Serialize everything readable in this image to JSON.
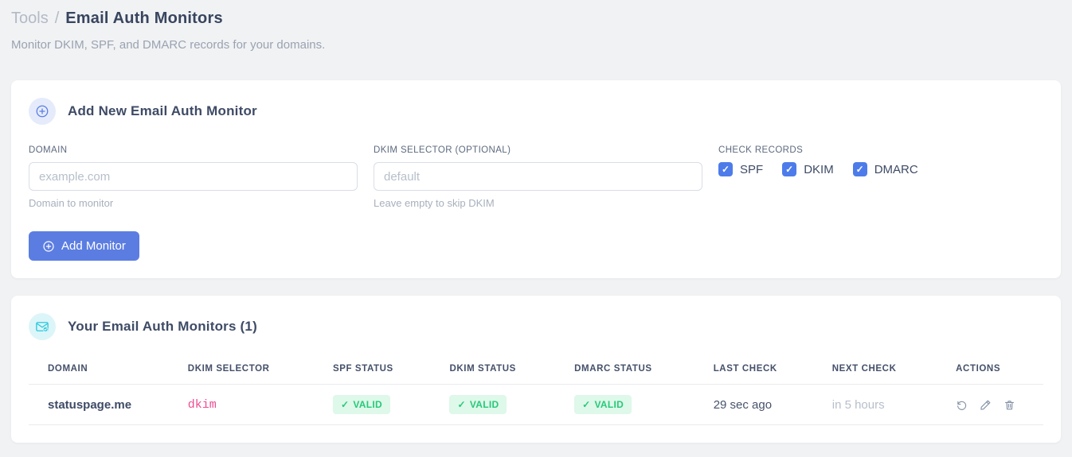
{
  "page": {
    "breadcrumb_root": "Tools",
    "breadcrumb_separator": "/",
    "title": "Email Auth Monitors",
    "subtitle": "Monitor DKIM, SPF, and DMARC records for your domains."
  },
  "glyphs": {
    "check": "✓"
  },
  "add_card": {
    "icon": "plus-circle-icon",
    "title": "Add New Email Auth Monitor",
    "domain_field": {
      "label": "DOMAIN",
      "placeholder": "example.com",
      "value": "",
      "hint": "Domain to monitor"
    },
    "dkim_field": {
      "label": "DKIM SELECTOR (OPTIONAL)",
      "placeholder": "default",
      "value": "",
      "hint": "Leave empty to skip DKIM"
    },
    "check_records": {
      "label": "CHECK RECORDS",
      "options": [
        {
          "label": "SPF",
          "checked": true
        },
        {
          "label": "DKIM",
          "checked": true
        },
        {
          "label": "DMARC",
          "checked": true
        }
      ]
    },
    "submit_label": "Add Monitor"
  },
  "monitors_card": {
    "icon": "email-check-icon",
    "title": "Your Email Auth Monitors (1)",
    "table": {
      "headers": {
        "domain": "DOMAIN",
        "dkim_selector": "DKIM SELECTOR",
        "spf_status": "SPF STATUS",
        "dkim_status": "DKIM STATUS",
        "dmarc_status": "DMARC STATUS",
        "last_check": "LAST CHECK",
        "next_check": "NEXT CHECK",
        "actions": "ACTIONS"
      },
      "rows": [
        {
          "domain": "statuspage.me",
          "dkim_selector": "dkim",
          "spf_status": "VALID",
          "dkim_status": "VALID",
          "dmarc_status": "VALID",
          "last_check": "29 sec ago",
          "next_check": "in 5 hours",
          "actions": [
            "refresh-icon",
            "edit-icon",
            "delete-icon"
          ]
        }
      ]
    }
  },
  "colors": {
    "accent_blue": "#5b7de2",
    "checkbox_blue": "#4d7cea",
    "valid_bg": "#def8e9",
    "valid_text": "#27c97a",
    "code_pink": "#ed4c92",
    "cyan": "#2bc9dd",
    "page_bg": "#f1f2f4"
  }
}
